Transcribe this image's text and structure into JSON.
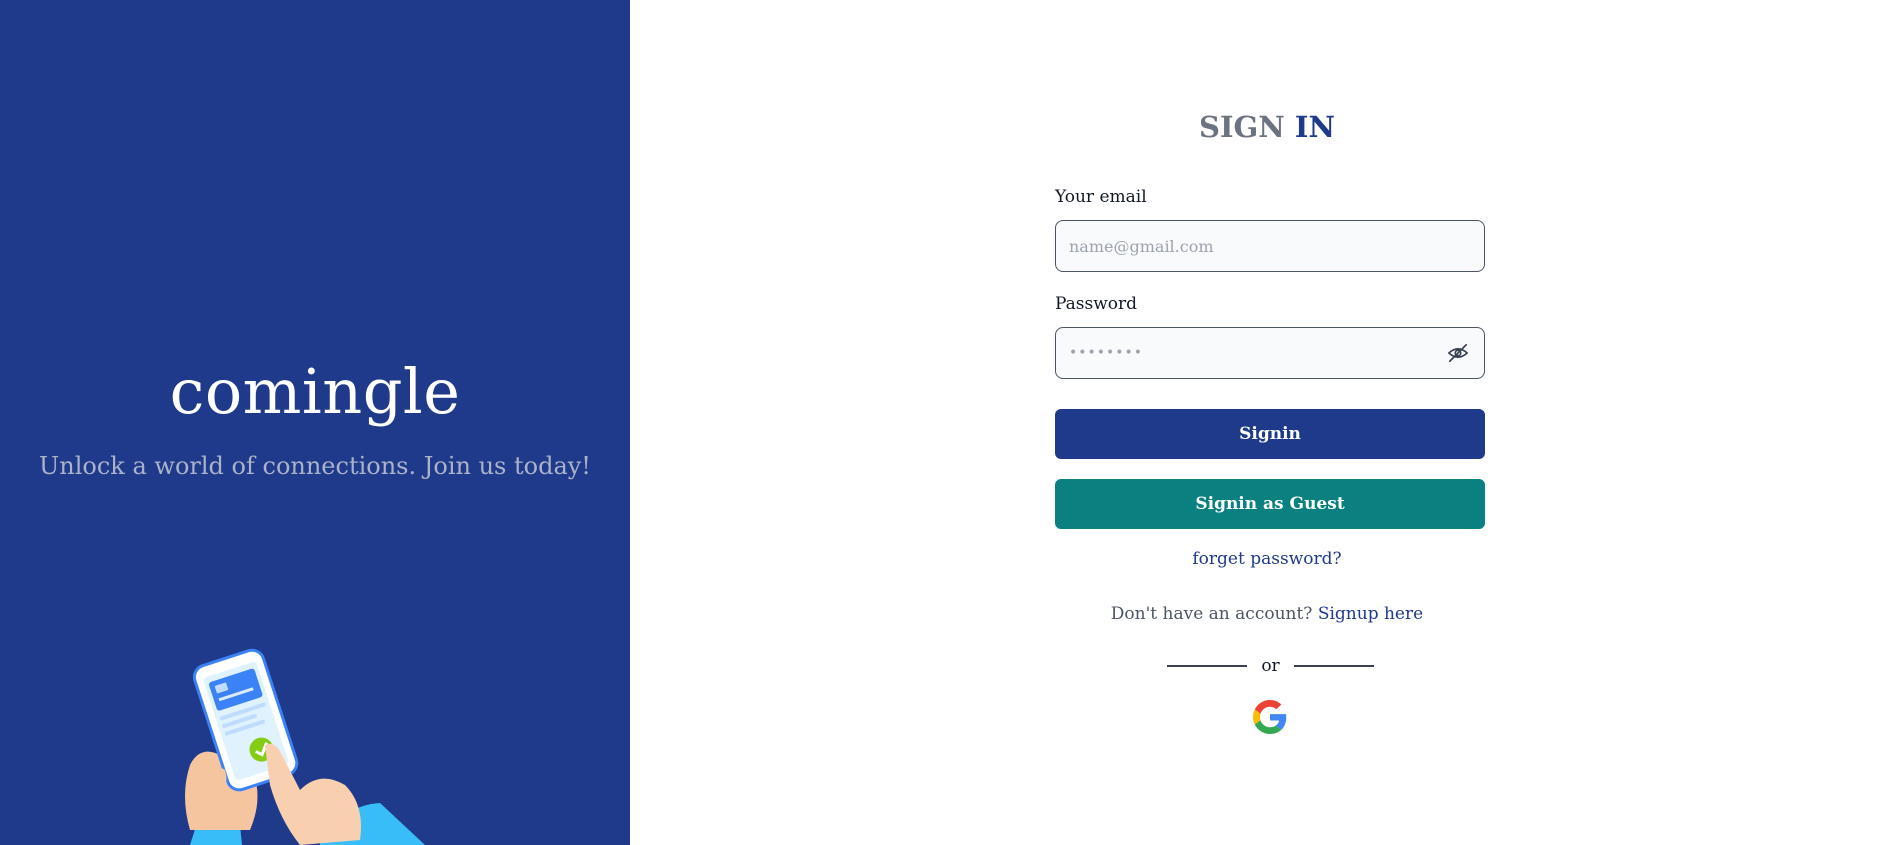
{
  "left_panel": {
    "brand": "comingle",
    "tagline": "Unlock a world of connections. Join us today!"
  },
  "form": {
    "title_part1": "SIGN",
    "title_part2": "IN",
    "email": {
      "label": "Your email",
      "placeholder": "name@gmail.com",
      "value": ""
    },
    "password": {
      "label": "Password",
      "masked_value": "••••••••",
      "toggle_icon": "eye-off-icon"
    },
    "signin_label": "Signin",
    "guest_label": "Signin as Guest",
    "forgot_label": "forget password?",
    "signup_prompt": "Don't have an account?",
    "signup_link": "Signup here",
    "divider_text": "or",
    "social_icon": "google-icon"
  },
  "colors": {
    "brand_blue": "#1f3a8a",
    "guest_teal": "#0b8080",
    "muted_text": "#6b7280"
  }
}
